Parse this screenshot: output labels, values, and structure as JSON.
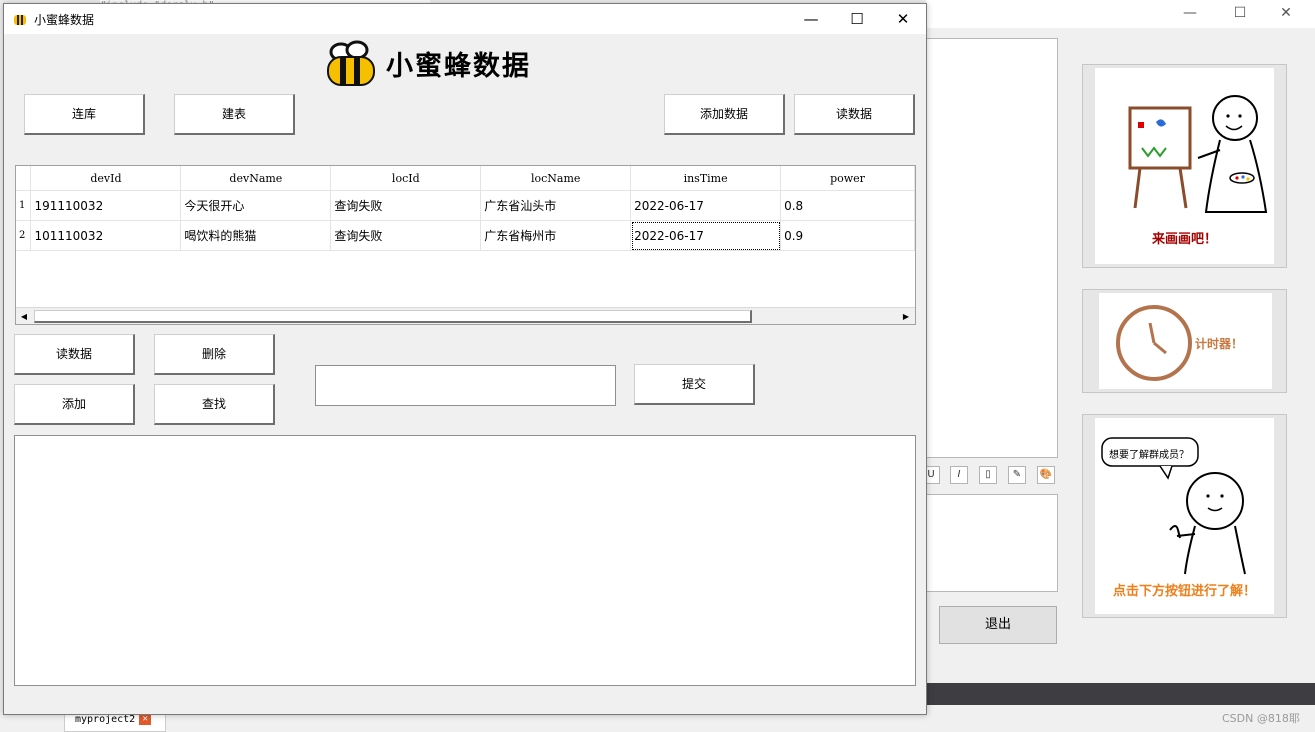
{
  "background_window": {
    "code_snippet": "#include \"dorslv.h\"",
    "exit_button": "退出",
    "cards": [
      {
        "caption": "来画画吧！",
        "caption_color": "#a40000"
      },
      {
        "caption": "计时器！",
        "caption_color": "#c87941"
      },
      {
        "caption": "点击下方按钮进行了解！",
        "caption_color": "#f07f1a",
        "bubble_text": "想要了解群成员？"
      }
    ],
    "format_buttons": [
      "U",
      "I",
      "▯",
      "✎",
      "🎨"
    ],
    "bottom_tab": "myproject2",
    "watermark": "CSDN @818耶"
  },
  "app": {
    "title": "小蜜蜂数据",
    "logo_text": "小蜜蜂数据",
    "accent_color": "#f6c000",
    "window_controls": {
      "minimize": "—",
      "maximize": "☐",
      "close": "✕"
    },
    "top_buttons": {
      "connect": "连库",
      "create_table": "建表",
      "add_data": "添加数据",
      "read_data": "读数据"
    },
    "table": {
      "columns": [
        "devId",
        "devName",
        "locId",
        "locName",
        "insTime",
        "power"
      ],
      "rows": [
        {
          "index": "1",
          "cells": [
            "191110032",
            "今天很开心",
            "查询失败",
            "广东省汕头市",
            "2022-06-17",
            "0.8"
          ]
        },
        {
          "index": "2",
          "cells": [
            "101110032",
            "喝饮料的熊猫",
            "查询失败",
            "广东省梅州市",
            "2022-06-17",
            "0.9"
          ]
        }
      ],
      "scroll_left": "◀",
      "scroll_right": "▶"
    },
    "bottom_buttons": {
      "read": "读数据",
      "delete": "删除",
      "add": "添加",
      "find": "查找",
      "submit": "提交"
    },
    "input": {
      "value": "",
      "placeholder": ""
    },
    "output": {
      "value": ""
    }
  }
}
